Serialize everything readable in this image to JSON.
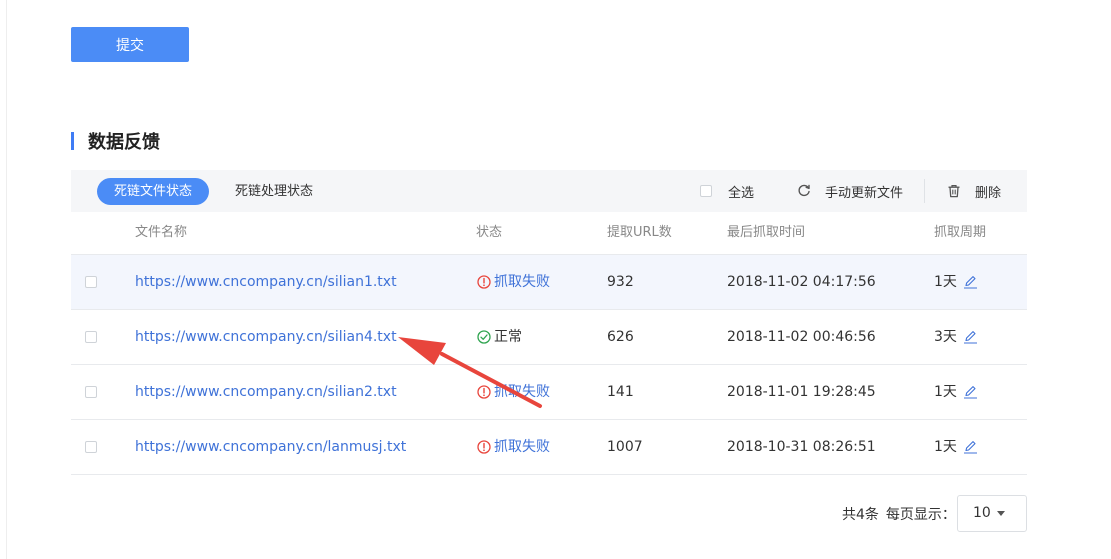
{
  "submit_label": "提交",
  "section_title": "数据反馈",
  "tabs": [
    {
      "label": "死链文件状态",
      "active": true
    },
    {
      "label": "死链处理状态",
      "active": false
    }
  ],
  "toolbar": {
    "select_all": "全选",
    "refresh_label": "手动更新文件",
    "delete_label": "删除"
  },
  "columns": [
    "文件名称",
    "状态",
    "提取URL数",
    "最后抓取时间",
    "抓取周期"
  ],
  "rows": [
    {
      "file": "https://www.cncompany.cn/silian1.txt",
      "status": "抓取失败",
      "status_type": "fail",
      "url_count": "932",
      "last_time": "2018-11-02 04:17:56",
      "period": "1天",
      "highlighted": true
    },
    {
      "file": "https://www.cncompany.cn/silian4.txt",
      "status": "正常",
      "status_type": "ok",
      "url_count": "626",
      "last_time": "2018-11-02 00:46:56",
      "period": "3天",
      "highlighted": false
    },
    {
      "file": "https://www.cncompany.cn/silian2.txt",
      "status": "抓取失败",
      "status_type": "fail",
      "url_count": "141",
      "last_time": "2018-11-01 19:28:45",
      "period": "1天",
      "highlighted": false
    },
    {
      "file": "https://www.cncompany.cn/lanmusj.txt",
      "status": "抓取失败",
      "status_type": "fail",
      "url_count": "1007",
      "last_time": "2018-10-31 08:26:51",
      "period": "1天",
      "highlighted": false
    }
  ],
  "pagination": {
    "total": "共4条",
    "per_page_label": "每页显示：",
    "per_page_value": "10"
  },
  "colors": {
    "accent": "#4b8cf6",
    "link": "#3f72d8",
    "fail_icon": "#e8453c",
    "ok_icon": "#2fa44f",
    "annotation_arrow": "#e8453c"
  },
  "icons": {
    "refresh": "refresh-icon",
    "delete": "trash-icon",
    "fail": "exclamation-circle-icon",
    "ok": "check-circle-icon",
    "edit": "pencil-icon"
  }
}
